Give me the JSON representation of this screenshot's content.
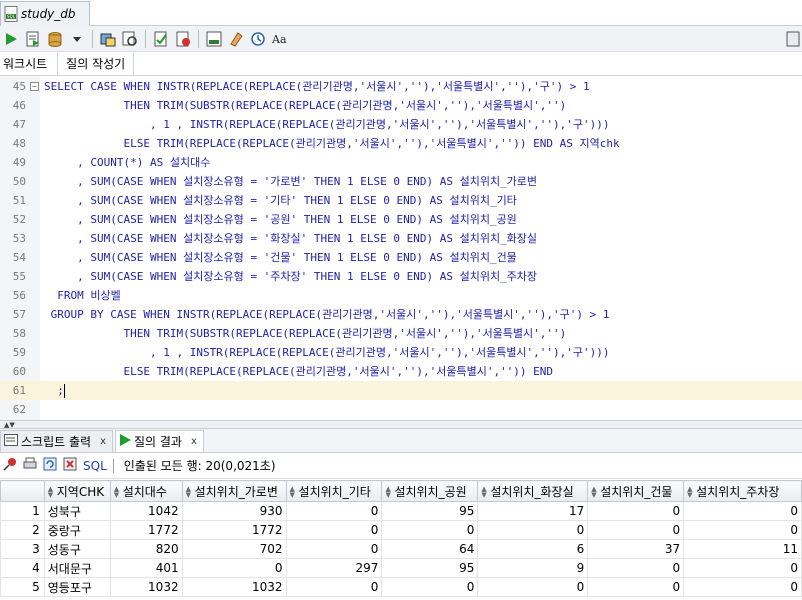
{
  "doc_tab": {
    "title": "study_db",
    "icon": "sql-icon"
  },
  "toolbar": {
    "buttons": [
      "run-statement-icon",
      "run-script-icon",
      "commit-icon",
      "rollback-icon",
      "explain-plan-icon",
      "autotrace-icon",
      "sql-tuning-icon",
      "clear-icon",
      "format-icon",
      "case-icon"
    ]
  },
  "subtabs": {
    "worksheet": "워크시트",
    "query_builder": "질의 작성기"
  },
  "editor": {
    "lines": [
      {
        "n": "45",
        "text": "SELECT CASE WHEN INSTR(REPLACE(REPLACE(관리기관명,'서울시',''),'서울특별시',''),'구') > 1",
        "fold": true
      },
      {
        "n": "46",
        "text": "            THEN TRIM(SUBSTR(REPLACE(REPLACE(관리기관명,'서울시',''),'서울특별시','')"
      },
      {
        "n": "47",
        "text": "                , 1 , INSTR(REPLACE(REPLACE(관리기관명,'서울시',''),'서울특별시',''),'구')))"
      },
      {
        "n": "48",
        "text": "            ELSE TRIM(REPLACE(REPLACE(관리기관명,'서울시',''),'서울특별시','')) END AS 지역chk"
      },
      {
        "n": "49",
        "text": "     , COUNT(*) AS 설치대수"
      },
      {
        "n": "50",
        "text": "     , SUM(CASE WHEN 설치장소유형 = '가로변' THEN 1 ELSE 0 END) AS 설치위치_가로변"
      },
      {
        "n": "51",
        "text": "     , SUM(CASE WHEN 설치장소유형 = '기타' THEN 1 ELSE 0 END) AS 설치위치_기타"
      },
      {
        "n": "52",
        "text": "     , SUM(CASE WHEN 설치장소유형 = '공원' THEN 1 ELSE 0 END) AS 설치위치_공원"
      },
      {
        "n": "53",
        "text": "     , SUM(CASE WHEN 설치장소유형 = '화장실' THEN 1 ELSE 0 END) AS 설치위치_화장실"
      },
      {
        "n": "54",
        "text": "     , SUM(CASE WHEN 설치장소유형 = '건물' THEN 1 ELSE 0 END) AS 설치위치_건물"
      },
      {
        "n": "55",
        "text": "     , SUM(CASE WHEN 설치장소유형 = '주차장' THEN 1 ELSE 0 END) AS 설치위치_주차장"
      },
      {
        "n": "56",
        "text": "  FROM 비상벨"
      },
      {
        "n": "57",
        "text": " GROUP BY CASE WHEN INSTR(REPLACE(REPLACE(관리기관명,'서울시',''),'서울특별시',''),'구') > 1"
      },
      {
        "n": "58",
        "text": "            THEN TRIM(SUBSTR(REPLACE(REPLACE(관리기관명,'서울시',''),'서울특별시','')"
      },
      {
        "n": "59",
        "text": "                , 1 , INSTR(REPLACE(REPLACE(관리기관명,'서울시',''),'서울특별시',''),'구')))"
      },
      {
        "n": "60",
        "text": "            ELSE TRIM(REPLACE(REPLACE(관리기관명,'서울시',''),'서울특별시','')) END"
      },
      {
        "n": "61",
        "text": "  ;",
        "current": true
      },
      {
        "n": "62",
        "text": ""
      }
    ]
  },
  "panel_tabs": {
    "script_output": "스크립트 출력",
    "query_result": "질의 결과",
    "close": "x"
  },
  "result_toolbar": {
    "sql_label": "SQL",
    "fetched_text": "인출된 모든 행: 20(0,021초)"
  },
  "grid": {
    "columns": [
      "지역CHK",
      "설치대수",
      "설치위치_가로변",
      "설치위치_기타",
      "설치위치_공원",
      "설치위치_화장실",
      "설치위치_건물",
      "설치위치_주차장"
    ],
    "rows": [
      {
        "n": "1",
        "cells": [
          "성북구",
          "1042",
          "930",
          "0",
          "95",
          "17",
          "0",
          "0"
        ]
      },
      {
        "n": "2",
        "cells": [
          "중랑구",
          "1772",
          "1772",
          "0",
          "0",
          "0",
          "0",
          "0"
        ]
      },
      {
        "n": "3",
        "cells": [
          "성동구",
          "820",
          "702",
          "0",
          "64",
          "6",
          "37",
          "11"
        ]
      },
      {
        "n": "4",
        "cells": [
          "서대문구",
          "401",
          "0",
          "297",
          "95",
          "9",
          "0",
          "0"
        ]
      },
      {
        "n": "5",
        "cells": [
          "영등포구",
          "1032",
          "1032",
          "0",
          "0",
          "0",
          "0",
          "0"
        ]
      }
    ]
  }
}
